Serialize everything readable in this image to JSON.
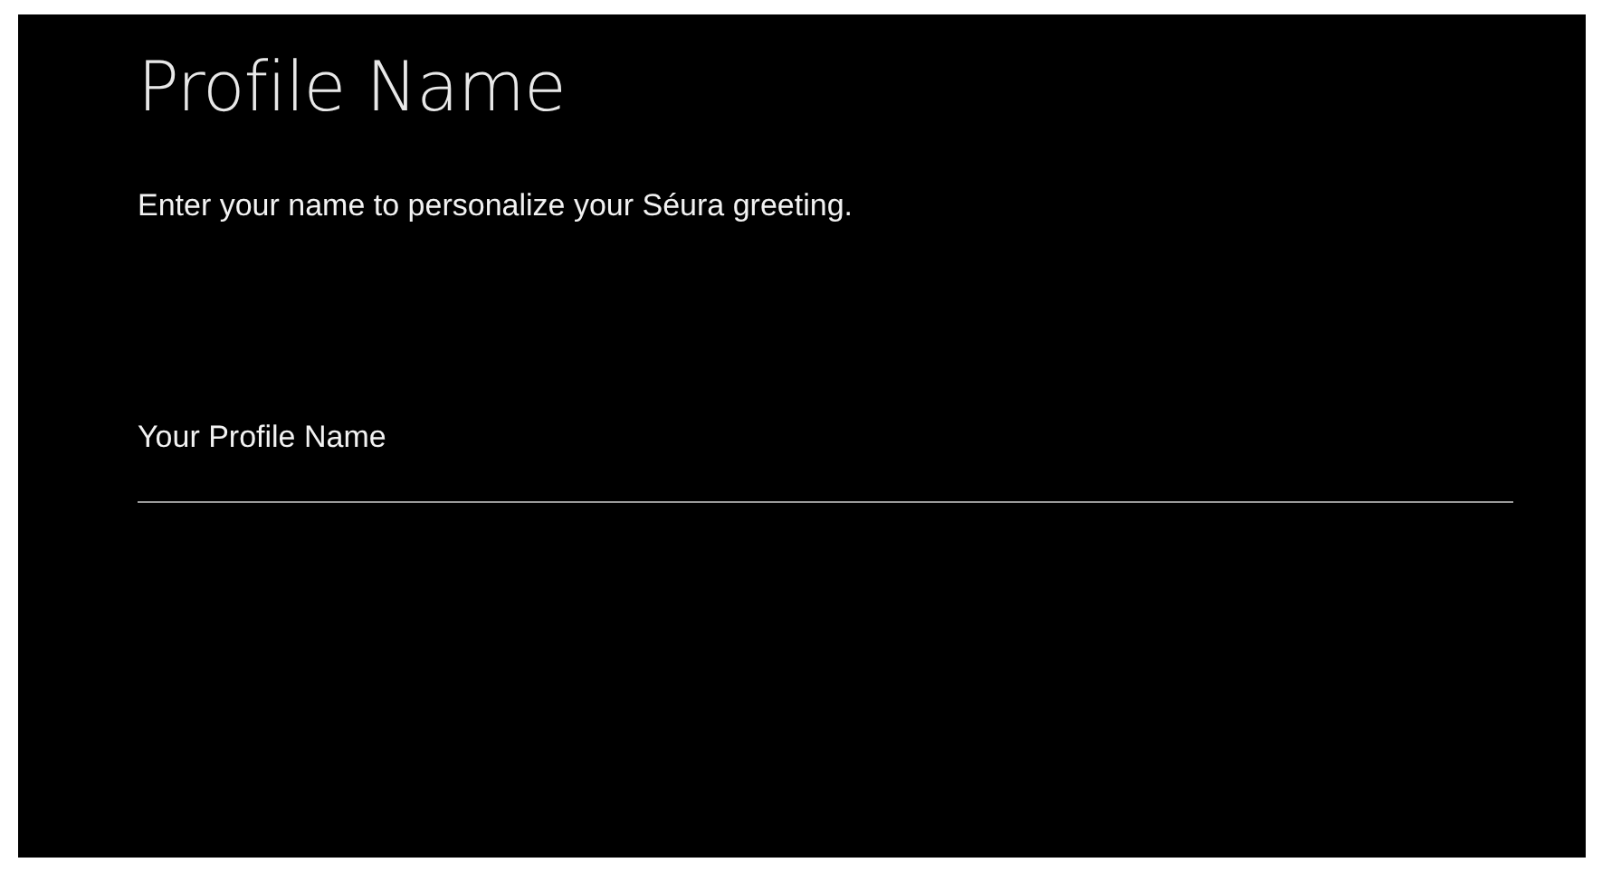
{
  "screen": {
    "title": "Profile Name",
    "description": "Enter your name to personalize your Séura greeting.",
    "name_field": {
      "placeholder": "Your Profile Name"
    }
  }
}
